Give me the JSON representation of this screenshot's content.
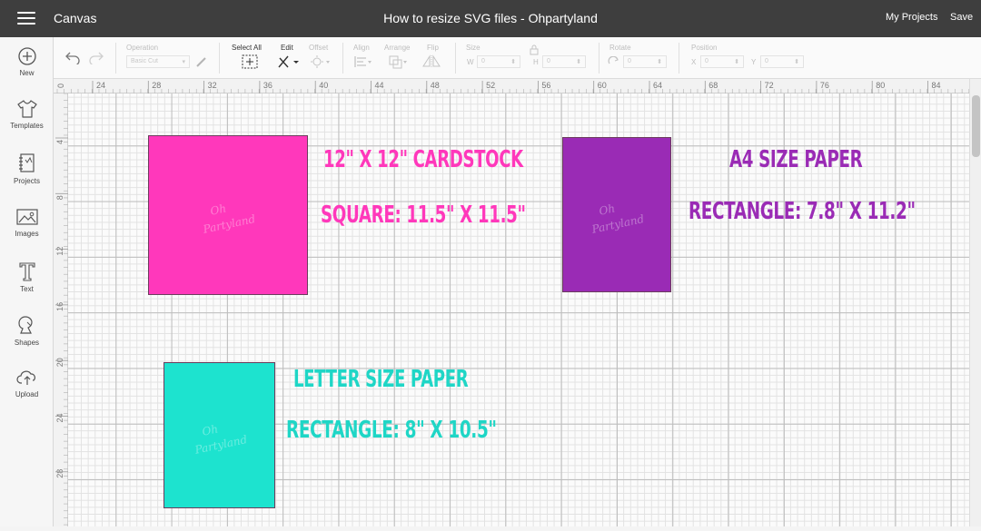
{
  "topbar": {
    "app_title": "Canvas",
    "document_title": "How to resize SVG files - Ohpartyland",
    "my_projects": "My Projects",
    "save": "Save"
  },
  "sidebar": {
    "items": [
      {
        "label": "New",
        "icon": "plus-circle-icon"
      },
      {
        "label": "Templates",
        "icon": "shirt-icon"
      },
      {
        "label": "Projects",
        "icon": "projects-icon"
      },
      {
        "label": "Images",
        "icon": "image-icon"
      },
      {
        "label": "Text",
        "icon": "text-icon"
      },
      {
        "label": "Shapes",
        "icon": "shapes-icon"
      },
      {
        "label": "Upload",
        "icon": "upload-cloud-icon"
      }
    ]
  },
  "toolbar": {
    "operation_label": "Operation",
    "operation_value": "Basic Cut",
    "select_all": "Select All",
    "edit": "Edit",
    "offset": "Offset",
    "align": "Align",
    "arrange": "Arrange",
    "flip": "Flip",
    "size": "Size",
    "size_w": "W",
    "size_h": "H",
    "size_w_value": "0",
    "size_h_value": "0",
    "rotate": "Rotate",
    "rotate_value": "0",
    "position": "Position",
    "pos_x": "X",
    "pos_y": "Y",
    "pos_x_value": "0",
    "pos_y_value": "0"
  },
  "ruler": {
    "top_ticks": [
      "0",
      "24",
      "28",
      "32",
      "36",
      "40",
      "44",
      "48",
      "52",
      "56",
      "60",
      "64",
      "68",
      "72",
      "76",
      "80",
      "84"
    ],
    "left_ticks": [
      "4",
      "8",
      "12",
      "16",
      "20",
      "24",
      "28"
    ]
  },
  "shapes": {
    "pink": {
      "color": "#ff38bb",
      "label_color": "#ff38bb",
      "title": "12\" X 12\" CARDSTOCK",
      "subtitle": "SQUARE: 11.5\" X 11.5\""
    },
    "purple": {
      "color": "#9a2bb5",
      "label_color": "#9a2bb5",
      "title": "A4 SIZE PAPER",
      "subtitle": "RECTANGLE: 7.8\" X 11.2\""
    },
    "teal": {
      "color": "#1de3cf",
      "label_color": "#1fd6c6",
      "title": "LETTER SIZE PAPER",
      "subtitle": "RECTANGLE: 8\" X 10.5\""
    }
  },
  "watermark": {
    "line1": "Oh",
    "line2": "Partyland"
  }
}
